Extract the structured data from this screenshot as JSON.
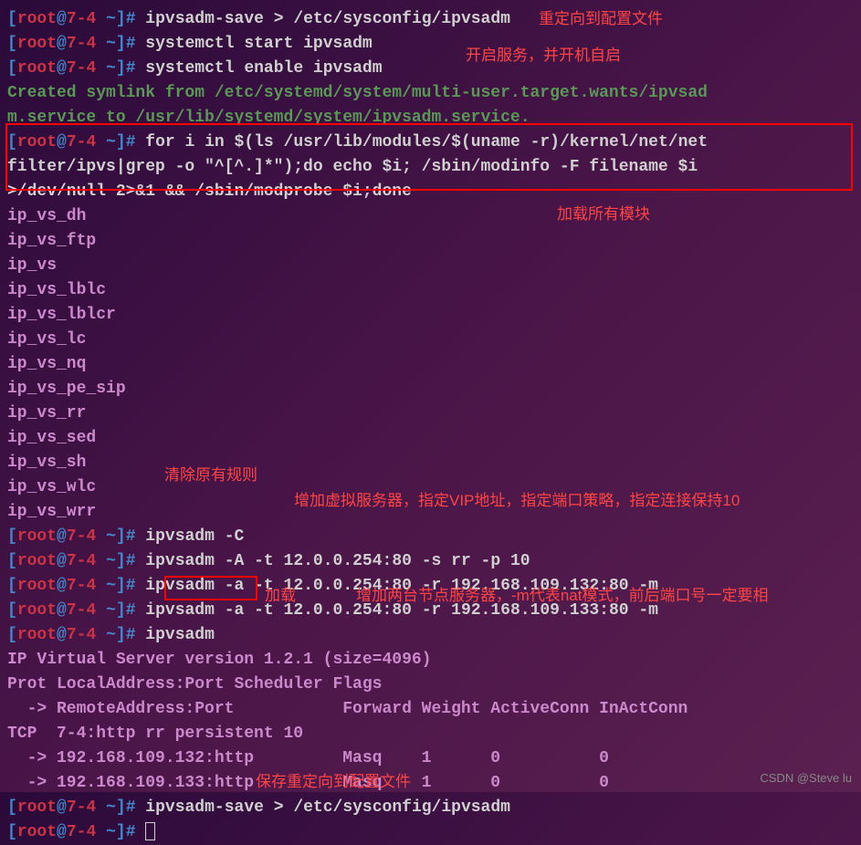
{
  "prompt": {
    "bracket_open": "[",
    "user": "root",
    "at": "@",
    "host": "7-4",
    "space": " ",
    "tilde": "~",
    "bracket_close": "]",
    "hash": "# "
  },
  "lines": {
    "cmd1": "ipvsadm-save > /etc/sysconfig/ipvsadm",
    "cmd2": "systemctl start ipvsadm",
    "cmd3": "systemctl enable ipvsadm",
    "symlink1": "Created symlink from /etc/systemd/system/multi-user.target.wants/ipvsad",
    "symlink2": "m.service to /usr/lib/systemd/system/ipvsadm.service.",
    "cmd4a": "for i in $(ls /usr/lib/modules/$(uname -r)/kernel/net/net",
    "cmd4b": "filter/ipvs|grep -o \"^[^.]*\");do echo $i; /sbin/modinfo -F filename $i ",
    "cmd4c": ">/dev/null 2>&1 && /sbin/modprobe $i;done",
    "mod1": "ip_vs_dh",
    "mod2": "ip_vs_ftp",
    "mod3": "ip_vs",
    "mod4": "ip_vs_lblc",
    "mod5": "ip_vs_lblcr",
    "mod6": "ip_vs_lc",
    "mod7": "ip_vs_nq",
    "mod8": "ip_vs_pe_sip",
    "mod9": "ip_vs_rr",
    "mod10": "ip_vs_sed",
    "mod11": "ip_vs_sh",
    "mod12": "ip_vs_wlc",
    "mod13": "ip_vs_wrr",
    "cmd5": "ipvsadm -C",
    "cmd6": "ipvsadm -A -t 12.0.0.254:80 -s rr -p 10",
    "cmd7": "ipvsadm -a -t 12.0.0.254:80 -r 192.168.109.132:80 -m",
    "cmd8": "ipvsadm -a -t 12.0.0.254:80 -r 192.168.109.133:80 -m",
    "cmd9": "ipvsadm",
    "out1": "IP Virtual Server version 1.2.1 (size=4096)",
    "out2": "Prot LocalAddress:Port Scheduler Flags",
    "out3": "  -> RemoteAddress:Port           Forward Weight ActiveConn InActConn",
    "out4": "TCP  7-4:http rr persistent 10",
    "out5": "  -> 192.168.109.132:http         Masq    1      0          0         ",
    "out6": "  -> 192.168.109.133:http         Masq    1      0          0         ",
    "cmd10": "ipvsadm-save > /etc/sysconfig/ipvsadm"
  },
  "annotations": {
    "a1": "重定向到配置文件",
    "a2": "开启服务，并开机自启",
    "a3": "加载所有模块",
    "a4": "清除原有规则",
    "a5": "增加虚拟服务器，指定VIP地址，指定端口策略，指定连接保持10",
    "a6": "加载",
    "a7": "增加两台节点服务器，-m代表nat模式，前后端口号一定要相",
    "a8": "保存重定向到配置文件"
  },
  "watermark": "CSDN @Steve lu"
}
